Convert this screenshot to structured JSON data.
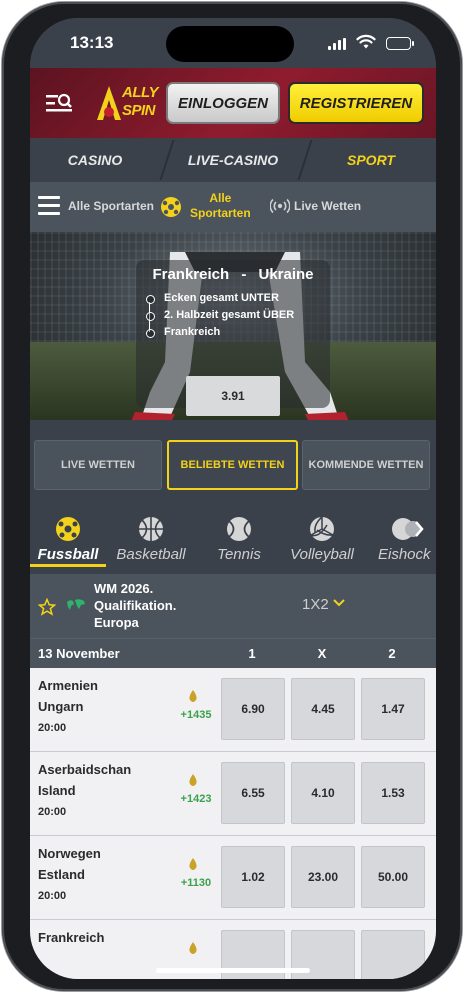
{
  "status": {
    "time": "13:13"
  },
  "header": {
    "logo_line1": "ALLY",
    "logo_line2": "SPIN",
    "login_label": "EINLOGGEN",
    "register_label": "REGISTRIEREN"
  },
  "main_tabs": [
    {
      "label": "CASINO"
    },
    {
      "label": "LIVE-CASINO"
    },
    {
      "label": "SPORT"
    }
  ],
  "sport_nav": {
    "all_sports": "Alle Sportarten",
    "active_line1": "Alle",
    "active_line2": "Sportarten",
    "live_bets": "Live Wetten"
  },
  "hero": {
    "team_home": "Frankreich",
    "separator": "-",
    "team_away": "Ukraine",
    "selections": [
      "Ecken gesamt UNTER",
      "2. Halbzeit gesamt ÜBER",
      "Frankreich"
    ],
    "odd": "3.91"
  },
  "bet_tabs": [
    {
      "label": "LIVE WETTEN"
    },
    {
      "label": "BELIEBTE WETTEN"
    },
    {
      "label": "KOMMENDE WETTEN"
    }
  ],
  "sports": [
    {
      "label": "Fussball",
      "icon": "football-icon"
    },
    {
      "label": "Basketball",
      "icon": "basketball-icon"
    },
    {
      "label": "Tennis",
      "icon": "tennis-icon"
    },
    {
      "label": "Volleyball",
      "icon": "volleyball-icon"
    },
    {
      "label": "Eishock",
      "icon": "hockey-icon"
    }
  ],
  "competition": {
    "name_line1": "WM 2026.",
    "name_line2": "Qualifikation.",
    "name_line3": "Europa",
    "market": "1X2"
  },
  "day_row": {
    "date": "13 November",
    "col1": "1",
    "colx": "X",
    "col2": "2"
  },
  "matches": [
    {
      "team1": "Armenien",
      "team2": "Ungarn",
      "time": "20:00",
      "more": "+1435",
      "odd1": "6.90",
      "oddx": "4.45",
      "odd2": "1.47"
    },
    {
      "team1": "Aserbaidschan",
      "team2": "Island",
      "time": "20:00",
      "more": "+1423",
      "odd1": "6.55",
      "oddx": "4.10",
      "odd2": "1.53"
    },
    {
      "team1": "Norwegen",
      "team2": "Estland",
      "time": "20:00",
      "more": "+1130",
      "odd1": "1.02",
      "oddx": "23.00",
      "odd2": "50.00"
    },
    {
      "team1": "Frankreich",
      "team2": "",
      "time": "",
      "more": "",
      "odd1": "",
      "oddx": "",
      "odd2": ""
    }
  ],
  "colors": {
    "accent": "#f3d21b",
    "brand_red": "#8f1c2e",
    "panel": "#3a414b",
    "positive": "#3aa14c"
  }
}
